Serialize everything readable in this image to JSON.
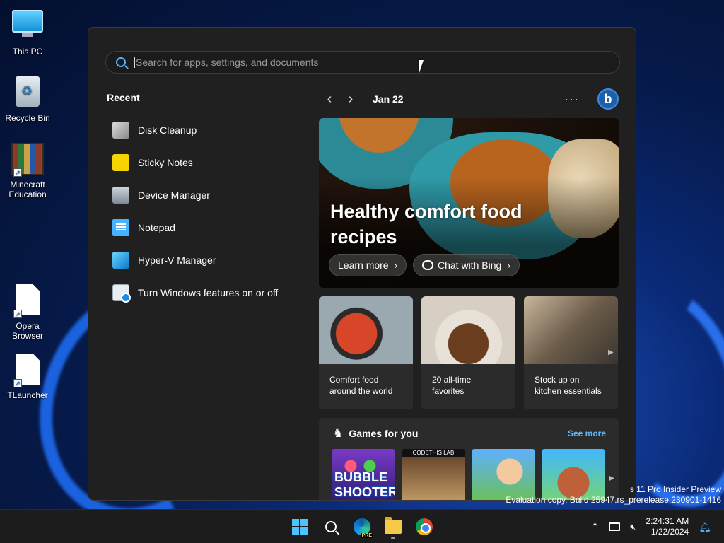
{
  "desktop": {
    "icons": [
      {
        "label": "This PC"
      },
      {
        "label": "Recycle Bin"
      },
      {
        "label": "Minecraft Education"
      },
      {
        "label": "Opera Browser"
      },
      {
        "label": "TLauncher"
      }
    ]
  },
  "start_menu": {
    "search": {
      "placeholder": "Search for apps, settings, and documents"
    },
    "recent": {
      "title": "Recent",
      "items": [
        {
          "label": "Disk Cleanup",
          "icon": "disk-cleanup-icon"
        },
        {
          "label": "Sticky Notes",
          "icon": "sticky-notes-icon"
        },
        {
          "label": "Device Manager",
          "icon": "device-manager-icon"
        },
        {
          "label": "Notepad",
          "icon": "notepad-icon"
        },
        {
          "label": "Hyper-V Manager",
          "icon": "hyper-v-icon"
        },
        {
          "label": "Turn Windows features on or off",
          "icon": "windows-features-icon"
        }
      ]
    },
    "feed": {
      "date": "Jan 22",
      "more": "···",
      "bing_label": "b",
      "hero": {
        "title": "Healthy comfort food recipes",
        "learn_more": "Learn more",
        "chat": "Chat with Bing"
      },
      "cards": [
        {
          "text": "Comfort food around the world"
        },
        {
          "text": "20 all-time favorites"
        },
        {
          "text": "Stock up on kitchen essentials"
        }
      ],
      "games": {
        "title": "Games for you",
        "see_more": "See more",
        "tiles": [
          {
            "label": "BUBBLE SHOOTER HD"
          },
          {
            "label": "CODETHIS LAB"
          },
          {
            "label": ""
          },
          {
            "label": ""
          }
        ]
      }
    }
  },
  "watermark": {
    "line1": "s 11 Pro Insider Preview",
    "line2": "Evaluation copy. Build 25947.rs_prerelease.230901-1416"
  },
  "taskbar": {
    "edge_badge": "PRE",
    "time": "2:24:31 AM",
    "date": "1/22/2024"
  },
  "colors": {
    "accent": "#4cc2ff",
    "link": "#5cb8ff",
    "menu_bg": "#202020"
  }
}
